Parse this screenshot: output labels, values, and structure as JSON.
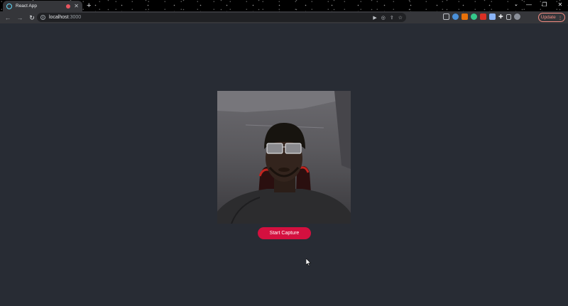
{
  "browser": {
    "tab_title": "React App",
    "url_host": "localhost",
    "url_port": ":3000",
    "update_label": "Update",
    "icons": {
      "favicon": "react-icon",
      "recording": "recording-dot-icon",
      "close": "close-icon",
      "new_tab": "plus-icon",
      "back": "back-arrow-icon",
      "forward": "forward-arrow-icon",
      "reload": "reload-icon",
      "site_info": "info-icon",
      "camera": "camera-icon",
      "share": "share-icon",
      "bookmark": "star-icon",
      "extensions": "puzzle-icon",
      "profile": "avatar"
    }
  },
  "app": {
    "start_button_label": "Start Capture"
  },
  "colors": {
    "page_background": "#282c34",
    "button_background": "#d4103f",
    "button_text": "#ffffff",
    "update_accent": "#f28b82"
  }
}
